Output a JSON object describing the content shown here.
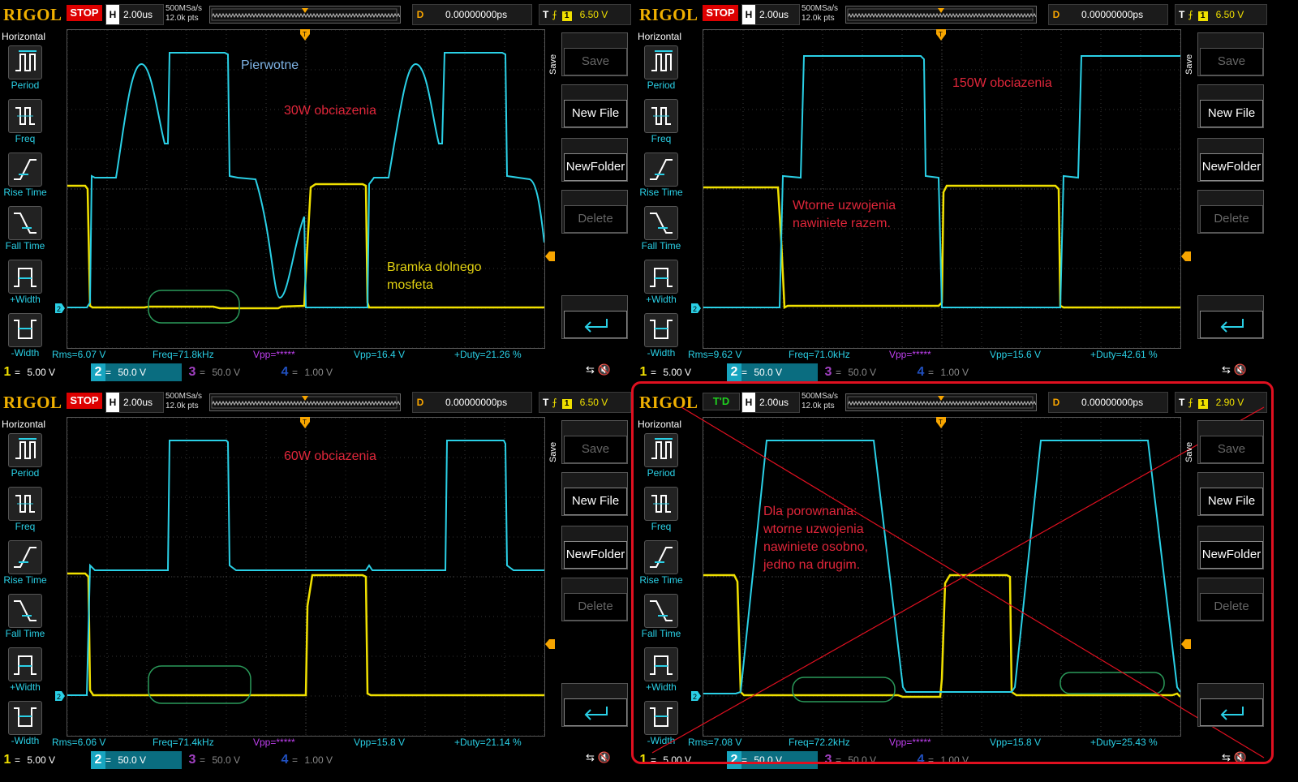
{
  "brand": "RIGOL",
  "sidebar": {
    "title": "Horizontal",
    "items": [
      {
        "label": "Period",
        "icon": "period-icon"
      },
      {
        "label": "Freq",
        "icon": "freq-icon"
      },
      {
        "label": "Rise Time",
        "icon": "rise-time-icon"
      },
      {
        "label": "Fall Time",
        "icon": "fall-time-icon"
      },
      {
        "label": "+Width",
        "icon": "pos-width-icon"
      },
      {
        "label": "-Width",
        "icon": "neg-width-icon"
      }
    ]
  },
  "save_menu": {
    "title": "Save",
    "save": "Save",
    "new_file": "New File",
    "new_folder": "NewFolder",
    "delete": "Delete"
  },
  "colors": {
    "ch1": "#f0e000",
    "ch2": "#2ad0e6",
    "annotation_red": "#e0263a",
    "highlight": "#e01020"
  },
  "channels": {
    "ch3_scale": "50.0 V",
    "ch4_scale": "1.00 V",
    "vpp_hidden": "Vpp=*****"
  },
  "panels": [
    {
      "status": "STOP",
      "h_label": "H",
      "h_scale": "2.00us",
      "sample_rate": "500MSa/s",
      "mem_depth": "12.0k pts",
      "d_label": "D",
      "delay": "0.00000000ps",
      "t_label": "T",
      "trigger_level": "6.50 V",
      "ch1_scale": "5.00 V",
      "ch2_scale": "50.0 V",
      "meas": {
        "rms": "Rms=6.07 V",
        "freq": "Freq=71.8kHz",
        "vpp": "Vpp=16.4 V",
        "duty": "+Duty=21.26 %"
      },
      "annotations": [
        "Pierwotne",
        "30W obciazenia",
        "Bramka dolnego",
        "mosfeta"
      ]
    },
    {
      "status": "STOP",
      "h_label": "H",
      "h_scale": "2.00us",
      "sample_rate": "500MSa/s",
      "mem_depth": "12.0k pts",
      "d_label": "D",
      "delay": "0.00000000ps",
      "t_label": "T",
      "trigger_level": "6.50 V",
      "ch1_scale": "5.00 V",
      "ch2_scale": "50.0 V",
      "meas": {
        "rms": "Rms=9.62 V",
        "freq": "Freq=71.0kHz",
        "vpp": "Vpp=15.6 V",
        "duty": "+Duty=42.61 %"
      },
      "annotations": [
        "150W obciazenia",
        "Wtorne uzwojenia",
        "nawiniete razem."
      ]
    },
    {
      "status": "STOP",
      "h_label": "H",
      "h_scale": "2.00us",
      "sample_rate": "500MSa/s",
      "mem_depth": "12.0k pts",
      "d_label": "D",
      "delay": "0.00000000ps",
      "t_label": "T",
      "trigger_level": "6.50 V",
      "ch1_scale": "5.00 V",
      "ch2_scale": "50.0 V",
      "meas": {
        "rms": "Rms=6.06 V",
        "freq": "Freq=71.4kHz",
        "vpp": "Vpp=15.8 V",
        "duty": "+Duty=21.14 %"
      },
      "annotations": [
        "60W obciazenia"
      ]
    },
    {
      "status": "T'D",
      "h_label": "H",
      "h_scale": "2.00us",
      "sample_rate": "500MSa/s",
      "mem_depth": "12.0k pts",
      "d_label": "D",
      "delay": "0.00000000ps",
      "t_label": "T",
      "trigger_level": "2.90 V",
      "ch1_scale": "5.00 V",
      "ch2_scale": "50.0 V",
      "meas": {
        "rms": "Rms=7.08 V",
        "freq": "Freq=72.2kHz",
        "vpp": "Vpp=15.8 V",
        "duty": "+Duty=25.43 %"
      },
      "annotations": [
        "Dla porownania:",
        "wtorne uzwojenia",
        "nawiniete osobno,",
        "jedno na drugim."
      ]
    }
  ]
}
